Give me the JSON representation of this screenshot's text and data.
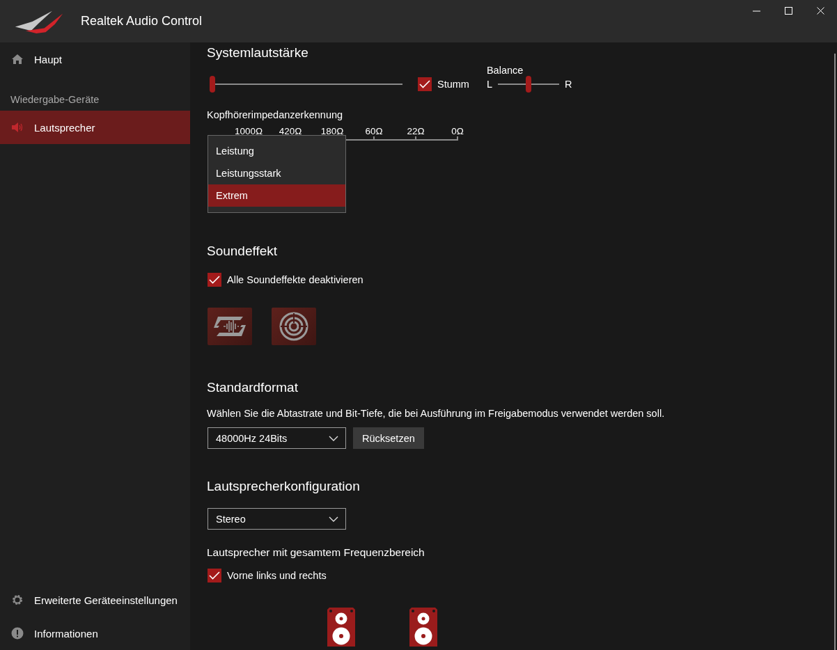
{
  "window": {
    "title": "Realtek Audio Control"
  },
  "sidebar": {
    "top_items": [
      {
        "label": "Haupt",
        "selected": false
      }
    ],
    "section_label": "Wiedergabe-Geräte",
    "devices": [
      {
        "label": "Lautsprecher",
        "selected": true
      }
    ],
    "bottom_items": [
      {
        "label": "Erweiterte Geräteeinstellungen",
        "selected": false
      },
      {
        "label": "Informationen",
        "selected": false
      }
    ]
  },
  "system_volume": {
    "title": "Systemlautstärke",
    "volume": {
      "level": 0
    },
    "mute": {
      "label": "Stumm",
      "checked": true
    },
    "balance": {
      "label": "Balance",
      "left": "L",
      "right": "R",
      "level": 0.5
    }
  },
  "impedance": {
    "title": "Kopfhörerimpedanzerkennung",
    "scale": [
      "1000Ω",
      "420Ω",
      "180Ω",
      "60Ω",
      "22Ω",
      "0Ω"
    ],
    "dropdown_options": [
      {
        "label": "Leistung",
        "selected": false
      },
      {
        "label": "Leistungsstark",
        "selected": false
      },
      {
        "label": "Extrem",
        "selected": true
      }
    ]
  },
  "sound_effect": {
    "title": "Soundeffekt",
    "disable_all": {
      "label": "Alle Soundeffekte deaktivieren",
      "checked": true
    }
  },
  "default_format": {
    "title": "Standardformat",
    "description": "Wählen Sie die Abtastrate und Bit-Tiefe, die bei Ausführung im Freigabemodus verwendet werden soll.",
    "format": "48000Hz 24Bits",
    "reset_button": "Rücksetzen"
  },
  "speaker_config": {
    "title": "Lautsprecherkonfiguration",
    "config": "Stereo",
    "fullrange_title": "Lautsprecher mit gesamtem Frequenzbereich",
    "front": {
      "label": "Vorne links und rechts",
      "checked": true
    }
  }
}
